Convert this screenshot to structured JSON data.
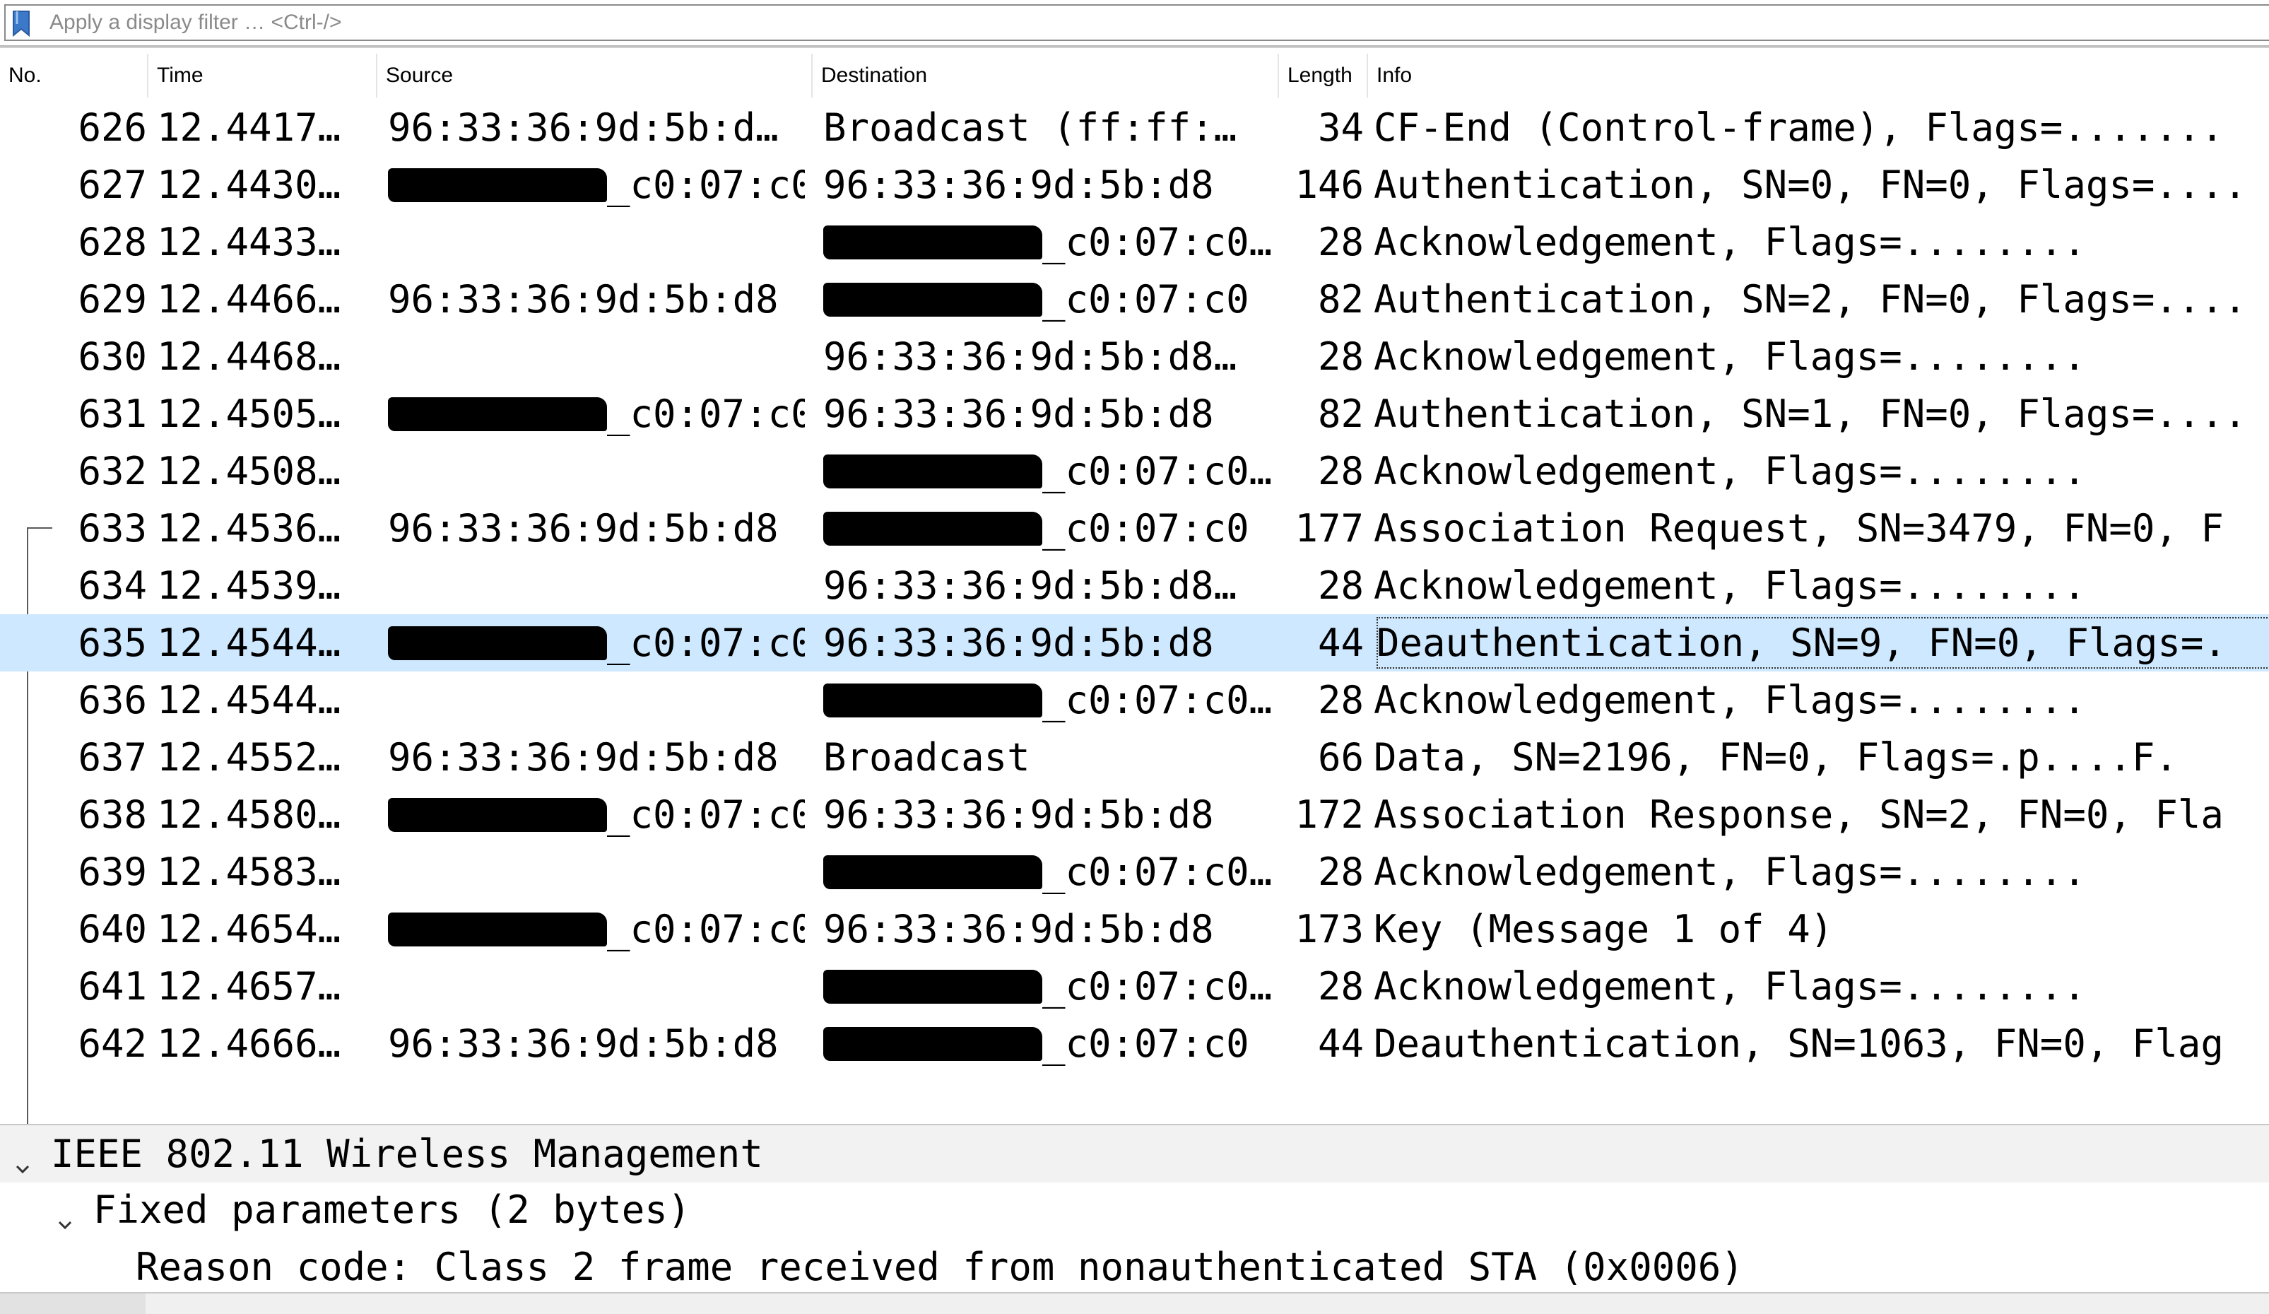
{
  "filter_bar": {
    "placeholder": "Apply a display filter … <Ctrl-/>",
    "value": ""
  },
  "packet_list": {
    "columns": [
      "No.",
      "Time",
      "Source",
      "Destination",
      "Length",
      "Info"
    ],
    "rows": [
      {
        "no": "626",
        "time": "12.4417…",
        "src": "96:33:36:9d:5b:d…",
        "dst": "Broadcast (ff:ff:…",
        "len": "34",
        "info": "CF-End (Control-frame), Flags=......."
      },
      {
        "no": "627",
        "time": "12.4430…",
        "src": "_c0:07:c0",
        "dst": "96:33:36:9d:5b:d8",
        "len": "146",
        "info": "Authentication, SN=0, FN=0, Flags=...."
      },
      {
        "no": "628",
        "time": "12.4433…",
        "src": "",
        "dst": "_c0:07:c0…",
        "len": "28",
        "info": "Acknowledgement, Flags=........"
      },
      {
        "no": "629",
        "time": "12.4466…",
        "src": "96:33:36:9d:5b:d8",
        "dst": "_c0:07:c0",
        "len": "82",
        "info": "Authentication, SN=2, FN=0, Flags=...."
      },
      {
        "no": "630",
        "time": "12.4468…",
        "src": "",
        "dst": "96:33:36:9d:5b:d8…",
        "len": "28",
        "info": "Acknowledgement, Flags=........"
      },
      {
        "no": "631",
        "time": "12.4505…",
        "src": "_c0:07:c0",
        "dst": "96:33:36:9d:5b:d8",
        "len": "82",
        "info": "Authentication, SN=1, FN=0, Flags=...."
      },
      {
        "no": "632",
        "time": "12.4508…",
        "src": "",
        "dst": "_c0:07:c0…",
        "len": "28",
        "info": "Acknowledgement, Flags=........"
      },
      {
        "no": "633",
        "time": "12.4536…",
        "src": "96:33:36:9d:5b:d8",
        "dst": "_c0:07:c0",
        "len": "177",
        "info": "Association Request, SN=3479, FN=0, F"
      },
      {
        "no": "634",
        "time": "12.4539…",
        "src": "",
        "dst": "96:33:36:9d:5b:d8…",
        "len": "28",
        "info": "Acknowledgement, Flags=........"
      },
      {
        "no": "635",
        "time": "12.4544…",
        "src": "_c0:07:c0",
        "dst": "96:33:36:9d:5b:d8",
        "len": "44",
        "info": "Deauthentication, SN=9, FN=0, Flags=."
      },
      {
        "no": "636",
        "time": "12.4544…",
        "src": "",
        "dst": "_c0:07:c0…",
        "len": "28",
        "info": "Acknowledgement, Flags=........"
      },
      {
        "no": "637",
        "time": "12.4552…",
        "src": "96:33:36:9d:5b:d8",
        "dst": "Broadcast",
        "len": "66",
        "info": "Data, SN=2196, FN=0, Flags=.p....F."
      },
      {
        "no": "638",
        "time": "12.4580…",
        "src": "_c0:07:c0",
        "dst": "96:33:36:9d:5b:d8",
        "len": "172",
        "info": "Association Response, SN=2, FN=0, Fla"
      },
      {
        "no": "639",
        "time": "12.4583…",
        "src": "",
        "dst": "_c0:07:c0…",
        "len": "28",
        "info": "Acknowledgement, Flags=........"
      },
      {
        "no": "640",
        "time": "12.4654…",
        "src": "_c0:07:c0",
        "dst": "96:33:36:9d:5b:d8",
        "len": "173",
        "info": "Key (Message 1 of 4)"
      },
      {
        "no": "641",
        "time": "12.4657…",
        "src": "",
        "dst": "_c0:07:c0…",
        "len": "28",
        "info": "Acknowledgement, Flags=........"
      },
      {
        "no": "642",
        "time": "12.4666…",
        "src": "96:33:36:9d:5b:d8",
        "dst": "_c0:07:c0",
        "len": "44",
        "info": "Deauthentication, SN=1063, FN=0, Flag"
      }
    ],
    "selected_no": "635"
  },
  "details": {
    "items": [
      {
        "label": "IEEE 802.11 Wireless Management",
        "expanded": true
      },
      {
        "label": "Fixed parameters (2 bytes)",
        "expanded": true
      },
      {
        "label": "Reason code: Class 2 frame received from nonauthenticated STA (0x0006)"
      }
    ]
  },
  "colors": {
    "selected_row": "#cde8ff",
    "redaction": "#000000"
  },
  "icons": {
    "bookmark": "bookmark-icon",
    "scroll_left": "chevron-left-icon",
    "expand": "chevron-down-icon"
  }
}
